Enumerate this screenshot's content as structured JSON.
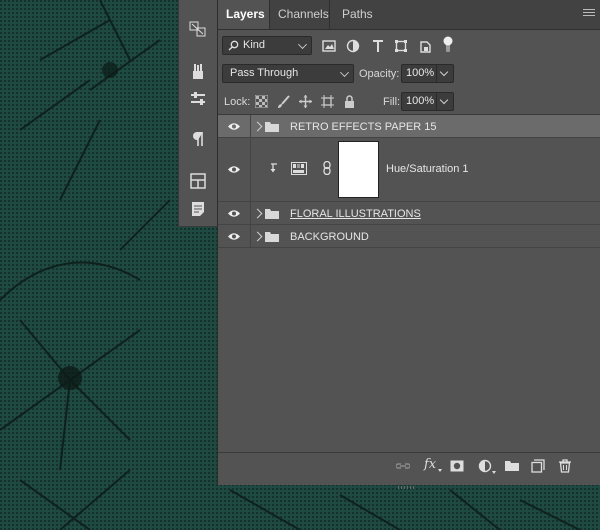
{
  "tabs": [
    {
      "label": "Layers",
      "active": true
    },
    {
      "label": "Channels",
      "active": false
    },
    {
      "label": "Paths",
      "active": false
    }
  ],
  "filter": {
    "kind_label": "Kind",
    "filter_icons": [
      "pixel-filter-icon",
      "adjustment-filter-icon",
      "type-filter-icon",
      "shape-filter-icon",
      "smart-object-filter-icon",
      "filter-toggle-icon"
    ]
  },
  "blend": {
    "mode": "Pass Through",
    "opacity_label": "Opacity:",
    "opacity_value": "100%"
  },
  "lock": {
    "label": "Lock:",
    "fill_label": "Fill:",
    "fill_value": "100%",
    "lock_icons": [
      "lock-transparent-pixels-icon",
      "lock-image-pixels-icon",
      "lock-position-icon",
      "lock-artboard-icon",
      "lock-all-icon"
    ]
  },
  "layers": [
    {
      "name": "RETRO EFFECTS PAPER 15",
      "type": "group",
      "visible": true,
      "selected": true
    },
    {
      "name": "Hue/Saturation 1",
      "type": "adjustment",
      "visible": true,
      "selected": false,
      "clipped": true
    },
    {
      "name": "FLORAL ILLUSTRATIONS",
      "type": "group",
      "visible": true,
      "selected": false
    },
    {
      "name": "BACKGROUND",
      "type": "group",
      "visible": true,
      "selected": false
    }
  ],
  "footer_icons": [
    "link-layers-icon",
    "fx-icon",
    "add-mask-icon",
    "new-adjustment-icon",
    "new-group-icon",
    "new-layer-icon",
    "delete-layer-icon"
  ],
  "footer": {
    "fx_label": "fx"
  },
  "tool_strip": [
    "history-icon",
    "brush-presets-icon",
    "properties-icon",
    "paragraph-icon",
    "libraries-icon",
    "notes-icon"
  ],
  "colors": {
    "panel_bg": "#535353",
    "selected_row": "#6b6b6b",
    "canvas_bg": "#1f4a42"
  }
}
